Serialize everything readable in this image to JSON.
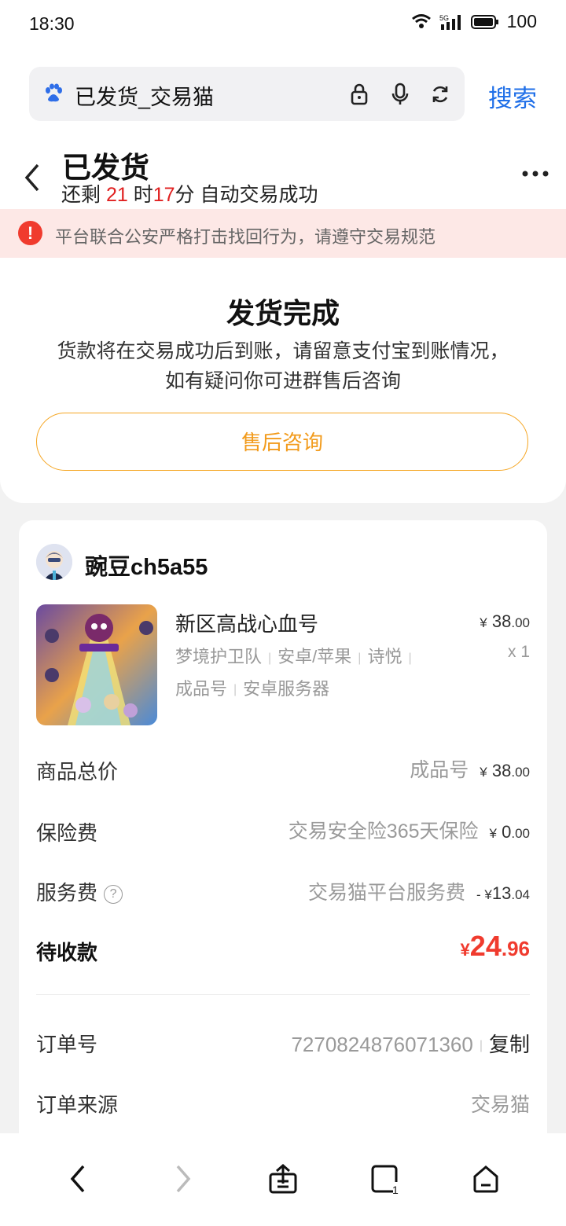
{
  "status_bar": {
    "time": "18:30",
    "battery": "100",
    "network": "5G"
  },
  "browser": {
    "query": "已发货_交易猫",
    "search_button": "搜索"
  },
  "header": {
    "title": "已发货",
    "countdown_prefix": "还剩 ",
    "hours": "21",
    "hours_unit": " 时",
    "minutes": "17",
    "minutes_suffix": "分 自动交易成功"
  },
  "notice": {
    "icon": "!",
    "text": "平台联合公安严格打击找回行为，请遵守交易规范"
  },
  "shipment": {
    "title": "发货完成",
    "desc_line1": "货款将在交易成功后到账，请留意支付宝到账情况，",
    "desc_line2": "如有疑问你可进群售后咨询",
    "button": "售后咨询"
  },
  "order": {
    "seller": "豌豆ch5a55",
    "product_name": "新区高战心血号",
    "tags_line1": [
      "梦境护卫队",
      "安卓/苹果",
      "诗悦"
    ],
    "tags_line2": [
      "成品号",
      "安卓服务器"
    ],
    "currency": "¥",
    "price_int": "38",
    "price_dec": ".00",
    "qty": "x 1",
    "rows": {
      "total": {
        "label": "商品总价",
        "detail": "成品号",
        "int": "38",
        "dec": ".00"
      },
      "insurance": {
        "label": "保险费",
        "detail": "交易安全险365天保险",
        "int": "0",
        "dec": ".00"
      },
      "service": {
        "label": "服务费",
        "detail": "交易猫平台服务费",
        "prefix": "- ¥",
        "int": "13",
        "dec": ".04"
      },
      "pending": {
        "label": "待收款",
        "int": "24",
        "dec": ".96"
      }
    },
    "order_no_label": "订单号",
    "order_no": "7270824876071360",
    "copy": "复制",
    "source_label": "订单来源",
    "source": "交易猫"
  },
  "colors": {
    "accent_blue": "#1f6fe8",
    "warn_orange": "#f29b1c",
    "price_red": "#f03b2e",
    "notice_bg": "#fde8e6"
  }
}
